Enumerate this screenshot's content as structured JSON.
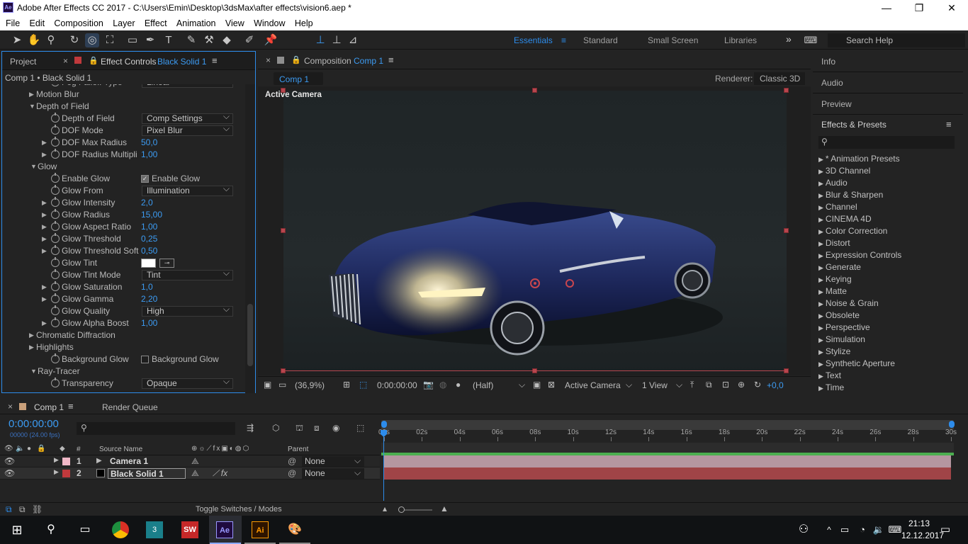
{
  "titlebar": {
    "app_icon": "Ae",
    "title": "Adobe After Effects CC 2017 - C:\\Users\\Emin\\Desktop\\3dsMax\\after effects\\vision6.aep *",
    "minimize": "—",
    "maximize": "❐",
    "close": "✕"
  },
  "menu": [
    "File",
    "Edit",
    "Composition",
    "Layer",
    "Effect",
    "Animation",
    "View",
    "Window",
    "Help"
  ],
  "workspaces": {
    "essentials": "Essentials",
    "standard": "Standard",
    "small_screen": "Small Screen",
    "libraries": "Libraries",
    "more": "»"
  },
  "search_help": {
    "placeholder": "Search Help"
  },
  "left_panel": {
    "tab_project": "Project",
    "tab_effect_controls": "Effect Controls",
    "tab_effect_layer": "Black Solid 1",
    "breadcrumb": "Comp 1 • Black Solid 1",
    "rows": [
      {
        "label": "Fog Falloff Type",
        "value": "Linear",
        "kind": "dropdown"
      },
      {
        "label": "Motion Blur",
        "kind": "group-closed"
      },
      {
        "label": "Depth of Field",
        "kind": "group-open"
      },
      {
        "label": "Depth of Field",
        "value": "Comp Settings",
        "kind": "dropdown"
      },
      {
        "label": "DOF Mode",
        "value": "Pixel Blur",
        "kind": "dropdown"
      },
      {
        "label": "DOF Max Radius",
        "value": "50,0",
        "kind": "value"
      },
      {
        "label": "DOF Radius Multipli",
        "value": "1,00",
        "kind": "value"
      },
      {
        "label": "Glow",
        "kind": "group-open"
      },
      {
        "label": "Enable Glow",
        "value": "Enable Glow",
        "kind": "checkbox-on"
      },
      {
        "label": "Glow From",
        "value": "Illumination",
        "kind": "dropdown"
      },
      {
        "label": "Glow Intensity",
        "value": "2,0",
        "kind": "value"
      },
      {
        "label": "Glow Radius",
        "value": "15,00",
        "kind": "value"
      },
      {
        "label": "Glow Aspect Ratio",
        "value": "1,00",
        "kind": "value"
      },
      {
        "label": "Glow Threshold",
        "value": "0,25",
        "kind": "value"
      },
      {
        "label": "Glow Threshold Soft",
        "value": "0,50",
        "kind": "value"
      },
      {
        "label": "Glow Tint",
        "kind": "color"
      },
      {
        "label": "Glow Tint Mode",
        "value": "Tint",
        "kind": "dropdown"
      },
      {
        "label": "Glow Saturation",
        "value": "1,0",
        "kind": "value"
      },
      {
        "label": "Glow Gamma",
        "value": "2,20",
        "kind": "value"
      },
      {
        "label": "Glow Quality",
        "value": "High",
        "kind": "dropdown"
      },
      {
        "label": "Glow Alpha Boost",
        "value": "1,00",
        "kind": "value"
      },
      {
        "label": "Chromatic Diffraction",
        "kind": "group-closed"
      },
      {
        "label": "Highlights",
        "kind": "group-closed"
      },
      {
        "label": "Background Glow",
        "value": "Background Glow",
        "kind": "checkbox-off"
      },
      {
        "label": "Ray-Tracer",
        "kind": "group-open-top"
      },
      {
        "label": "Transparency",
        "value": "Opaque",
        "kind": "dropdown"
      }
    ]
  },
  "composition": {
    "tab_label": "Composition",
    "tab_comp": "Comp 1",
    "comp_chip": "Comp 1",
    "renderer_label": "Renderer:",
    "renderer_value": "Classic 3D",
    "view_label": "Active Camera",
    "zoom": "(36,9%)",
    "timecode": "0:00:00:00",
    "resolution": "(Half)",
    "camera": "Active Camera",
    "views": "1 View",
    "exposure": "+0,0"
  },
  "right_panel": {
    "info": "Info",
    "audio": "Audio",
    "preview": "Preview",
    "effects_presets": "Effects & Presets",
    "effects": [
      "* Animation Presets",
      "3D Channel",
      "Audio",
      "Blur & Sharpen",
      "Channel",
      "CINEMA 4D",
      "Color Correction",
      "Distort",
      "Expression Controls",
      "Generate",
      "Keying",
      "Matte",
      "Noise & Grain",
      "Obsolete",
      "Perspective",
      "Simulation",
      "Stylize",
      "Synthetic Aperture",
      "Text",
      "Time"
    ]
  },
  "timeline": {
    "tab_comp": "Comp 1",
    "tab_render_queue": "Render Queue",
    "timecode": "0:00:00:00",
    "fps": "00000 (24.00 fps)",
    "col_num": "#",
    "col_source": "Source Name",
    "col_parent": "Parent",
    "ruler": [
      "00s",
      "02s",
      "04s",
      "06s",
      "08s",
      "10s",
      "12s",
      "14s",
      "16s",
      "18s",
      "20s",
      "22s",
      "24s",
      "26s",
      "28s",
      "30s"
    ],
    "layers": [
      {
        "num": "1",
        "name": "Camera 1",
        "parent": "None",
        "color": "#f1b8c7"
      },
      {
        "num": "2",
        "name": "Black Solid 1",
        "parent": "None",
        "color": "#c0393c"
      }
    ],
    "toggle_label": "Toggle Switches / Modes"
  },
  "taskbar": {
    "time": "21:13",
    "date": "12.12.2017"
  }
}
